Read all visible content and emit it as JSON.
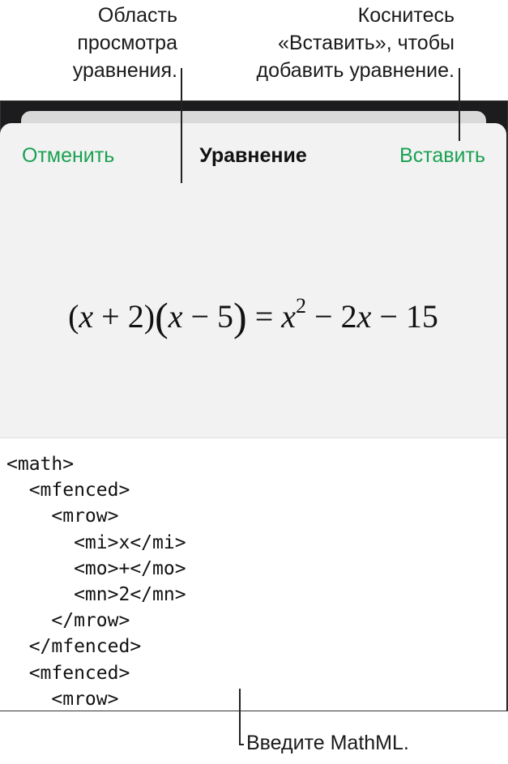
{
  "callouts": {
    "preview_area": "Область\nпросмотра\nуравнения.",
    "insert_hint": "Коснитесь\n«Вставить», чтобы\nдобавить уравнение.",
    "enter_mathml": "Введите MathML."
  },
  "nav": {
    "cancel_label": "Отменить",
    "title": "Уравнение",
    "insert_label": "Вставить"
  },
  "preview": {
    "equation": {
      "open1": "(",
      "x1": "x",
      "plus": " + ",
      "two": "2",
      "close1": ")",
      "open2": "(",
      "x2": "x",
      "minus1": " − ",
      "five": "5",
      "close2": ")",
      "eq": " = ",
      "x3": "x",
      "exp": "2",
      "minus2": " − ",
      "two_x_coef": "2",
      "x4": "x",
      "minus3": " − ",
      "fifteen": "15"
    }
  },
  "editor": {
    "lines": [
      "<math>",
      "  <mfenced>",
      "    <mrow>",
      "      <mi>x</mi>",
      "      <mo>+</mo>",
      "      <mn>2</mn>",
      "    </mrow>",
      "  </mfenced>",
      "  <mfenced>",
      "    <mrow>"
    ]
  },
  "colors": {
    "accent": "#1aa152",
    "frame": "#1c1c1e",
    "sheet": "#f2f2f2",
    "editor": "#ffffff"
  }
}
